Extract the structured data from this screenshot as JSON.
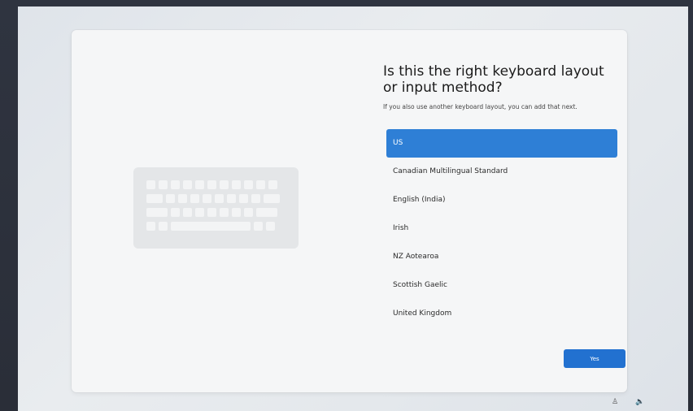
{
  "oobe": {
    "title": "Is this the right keyboard layout or input method?",
    "subtitle": "If you also use another keyboard layout, you can add that next.",
    "layouts": [
      "US",
      "Canadian Multilingual Standard",
      "English (India)",
      "Irish",
      "NZ Aotearoa",
      "Scottish Gaelic",
      "United Kingdom"
    ],
    "selected_index": 0,
    "yes_label": "Yes"
  },
  "colors": {
    "accent": "#2271d0",
    "selected_row": "#2e7fd6",
    "card_background": "#f5f6f7"
  },
  "icons": {
    "illustration": "keyboard-illustration",
    "tray": [
      "accessibility-icon",
      "volume-icon"
    ]
  },
  "tray_glyphs": {
    "accessibility": "♙",
    "volume": "🔈"
  }
}
